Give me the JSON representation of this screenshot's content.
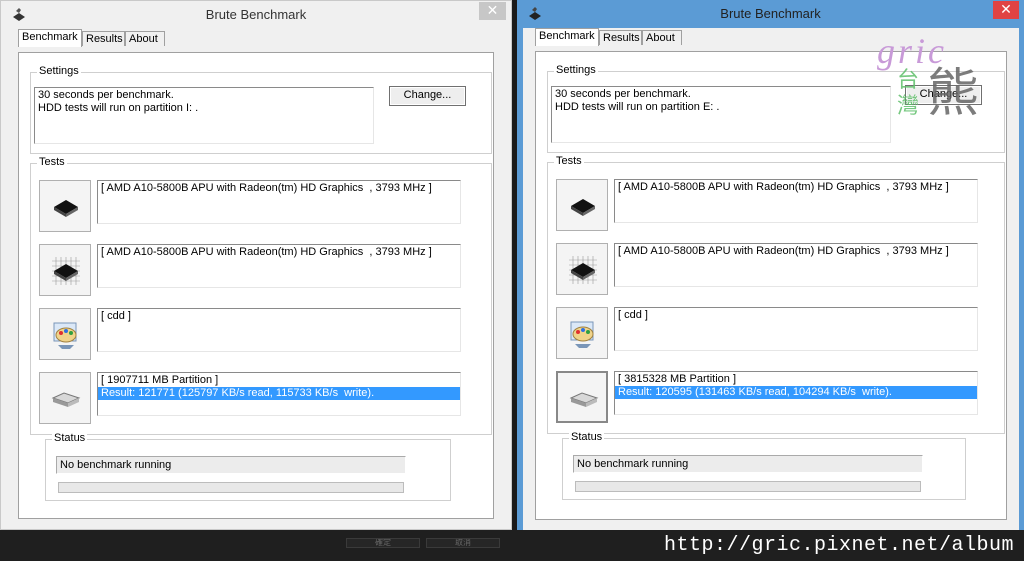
{
  "windows": [
    {
      "id": "left",
      "title": "Brute Benchmark",
      "tabs": [
        "Benchmark",
        "Results",
        "About"
      ],
      "settings_label": "Settings",
      "settings_text": "30 seconds per benchmark.\nHDD tests will run on partition I: .",
      "change_label": "Change...",
      "tests_label": "Tests",
      "tests": [
        {
          "icon": "cpu-chip-icon",
          "text": "[ AMD A10-5800B APU with Radeon(tm) HD Graphics  , 3793 MHz ]",
          "selected": ""
        },
        {
          "icon": "cpu-grid-icon",
          "text": "[ AMD A10-5800B APU with Radeon(tm) HD Graphics  , 3793 MHz ]",
          "selected": ""
        },
        {
          "icon": "paint-palette-icon",
          "text": "[ cdd ]",
          "selected": ""
        },
        {
          "icon": "hard-drive-icon",
          "text": "[ 1907711 MB Partition ]",
          "selected": "Result: 121771 (125797 KB/s read, 115733 KB/s  write)."
        }
      ],
      "status_label": "Status",
      "status_text": "No benchmark running"
    },
    {
      "id": "right",
      "title": "Brute Benchmark",
      "tabs": [
        "Benchmark",
        "Results",
        "About"
      ],
      "settings_label": "Settings",
      "settings_text": "30 seconds per benchmark.\nHDD tests will run on partition E: .",
      "change_label": "Change...",
      "tests_label": "Tests",
      "tests": [
        {
          "icon": "cpu-chip-icon",
          "text": "[ AMD A10-5800B APU with Radeon(tm) HD Graphics  , 3793 MHz ]",
          "selected": ""
        },
        {
          "icon": "cpu-grid-icon",
          "text": "[ AMD A10-5800B APU with Radeon(tm) HD Graphics  , 3793 MHz ]",
          "selected": ""
        },
        {
          "icon": "paint-palette-icon",
          "text": "[ cdd ]",
          "selected": ""
        },
        {
          "icon": "hard-drive-icon",
          "text": "[ 3815328 MB Partition ]",
          "selected": "Result: 120595 (131463 KB/s read, 104294 KB/s  write)."
        }
      ],
      "status_label": "Status",
      "status_text": "No benchmark running"
    }
  ],
  "footer_buttons": [
    "確定",
    "取消"
  ],
  "watermark": {
    "url": "http://gric.pixnet.net/album",
    "logo_text": "gric",
    "logo_cn_small": "台灣",
    "logo_cn_big": "熊"
  },
  "colors": {
    "selection": "#3399ff",
    "right_frame": "#5b9bd5",
    "close_red": "#e04343"
  }
}
